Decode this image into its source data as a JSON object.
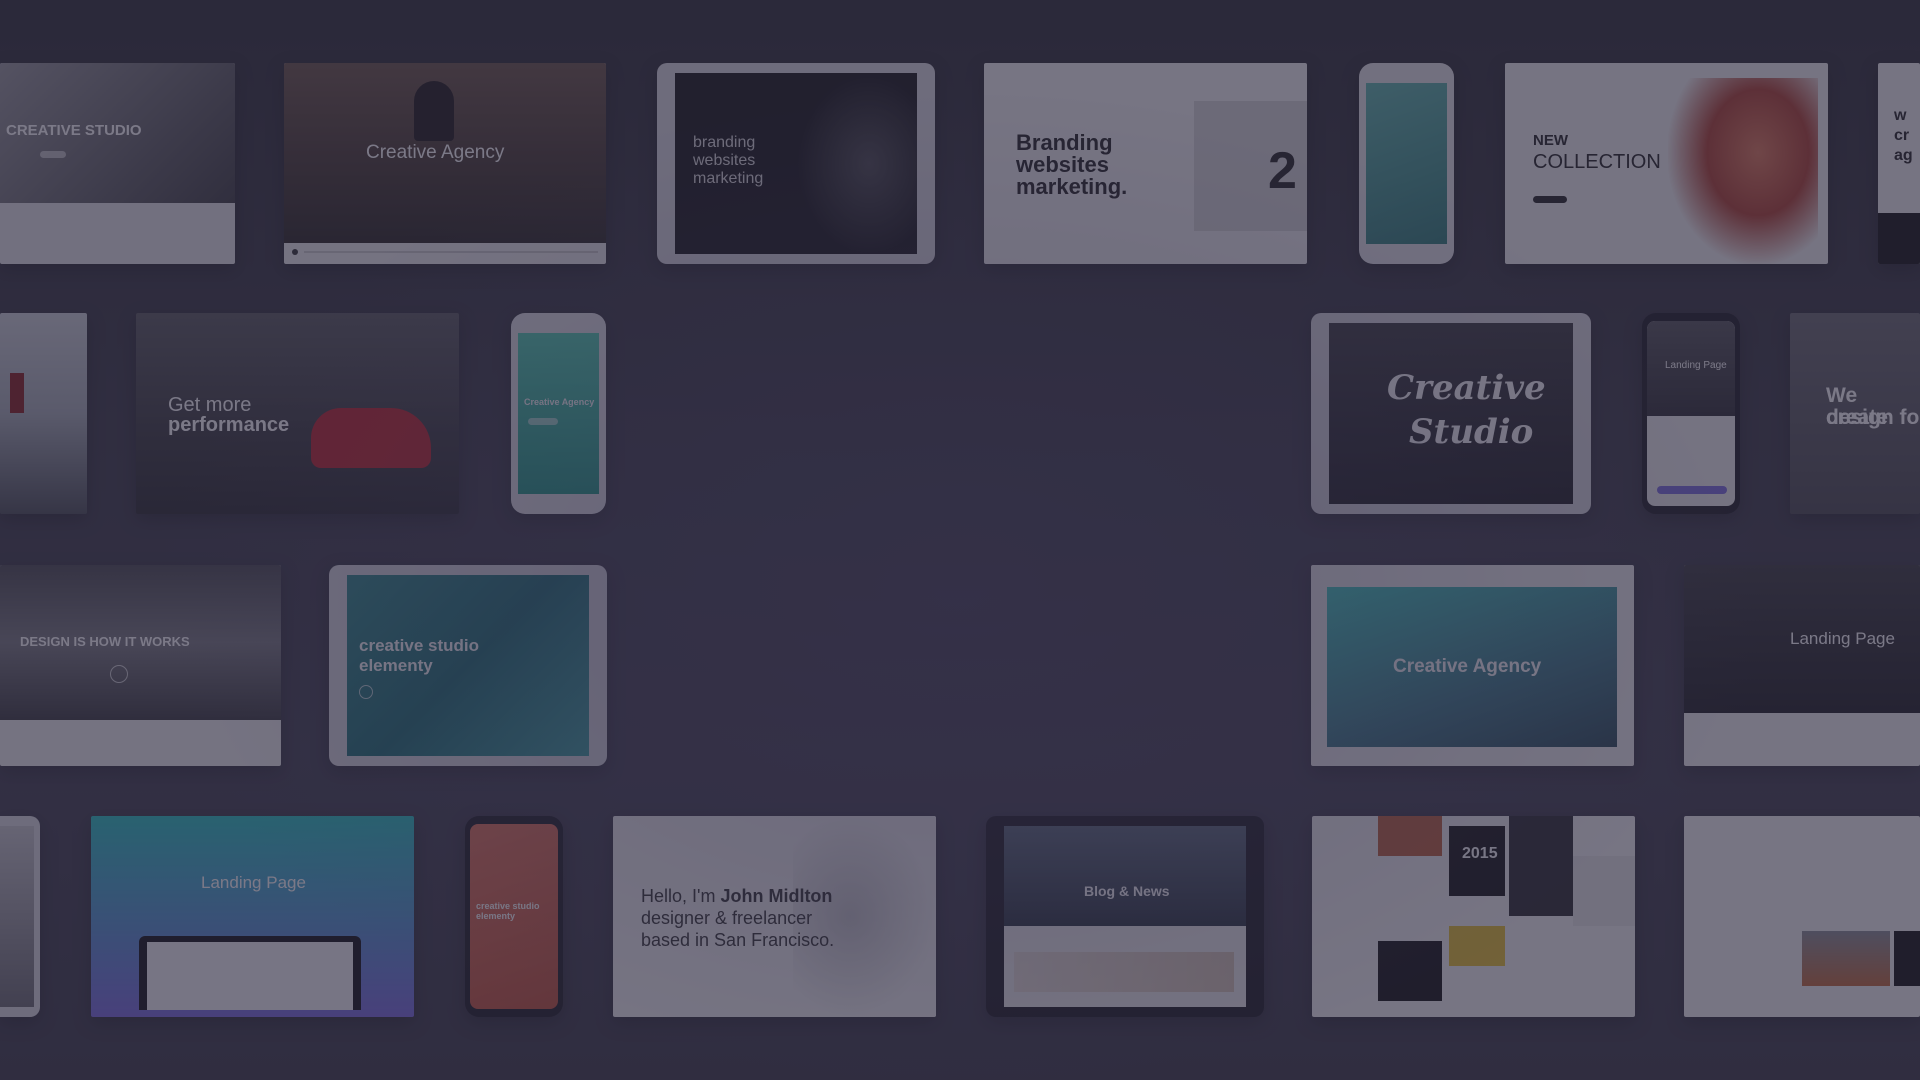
{
  "mockups": {
    "creative_studio": {
      "title": "CREATIVE STUDIO"
    },
    "creative_agency_1": {
      "title": "Creative Agency"
    },
    "branding_tablet": {
      "lines": [
        "branding",
        "websites",
        "marketing"
      ]
    },
    "branding_web": {
      "lines": [
        "Branding",
        "websites",
        "marketing."
      ],
      "number": "2"
    },
    "new_collection": {
      "line1": "NEW",
      "line2": "COLLECTION"
    },
    "far_right_top": {
      "lines": [
        "w",
        "cr",
        "ag"
      ]
    },
    "performance": {
      "line1": "Get more",
      "line2": "performance"
    },
    "phone_agency": {
      "title": "Creative Agency"
    },
    "creative_studio_script": {
      "line1": "Creative",
      "line2": "Studio"
    },
    "phone_landing": {
      "title": "Landing Page"
    },
    "we_create": {
      "line1": "We create",
      "line2": "design fo"
    },
    "design_how": {
      "title": "DESIGN IS HOW IT WORKS"
    },
    "elementy": {
      "line1": "creative studio",
      "line2": "elementy"
    },
    "creative_agency_2": {
      "title": "Creative Agency"
    },
    "landing_page_1": {
      "title": "Landing Page"
    },
    "landing_page_2": {
      "title": "Landing Page"
    },
    "phone_elementy": {
      "line1": "creative studio",
      "line2": "elementy"
    },
    "john": {
      "prefix": "Hello, I'm ",
      "name": "John Midlton",
      "line2": "designer & freelancer",
      "line3": "based in San Francisco."
    },
    "blog": {
      "title": "Blog & News"
    },
    "portfolio": {
      "num": "2015"
    }
  },
  "colors": {
    "overlay": "#2a263e",
    "background": "#3a3a44"
  }
}
